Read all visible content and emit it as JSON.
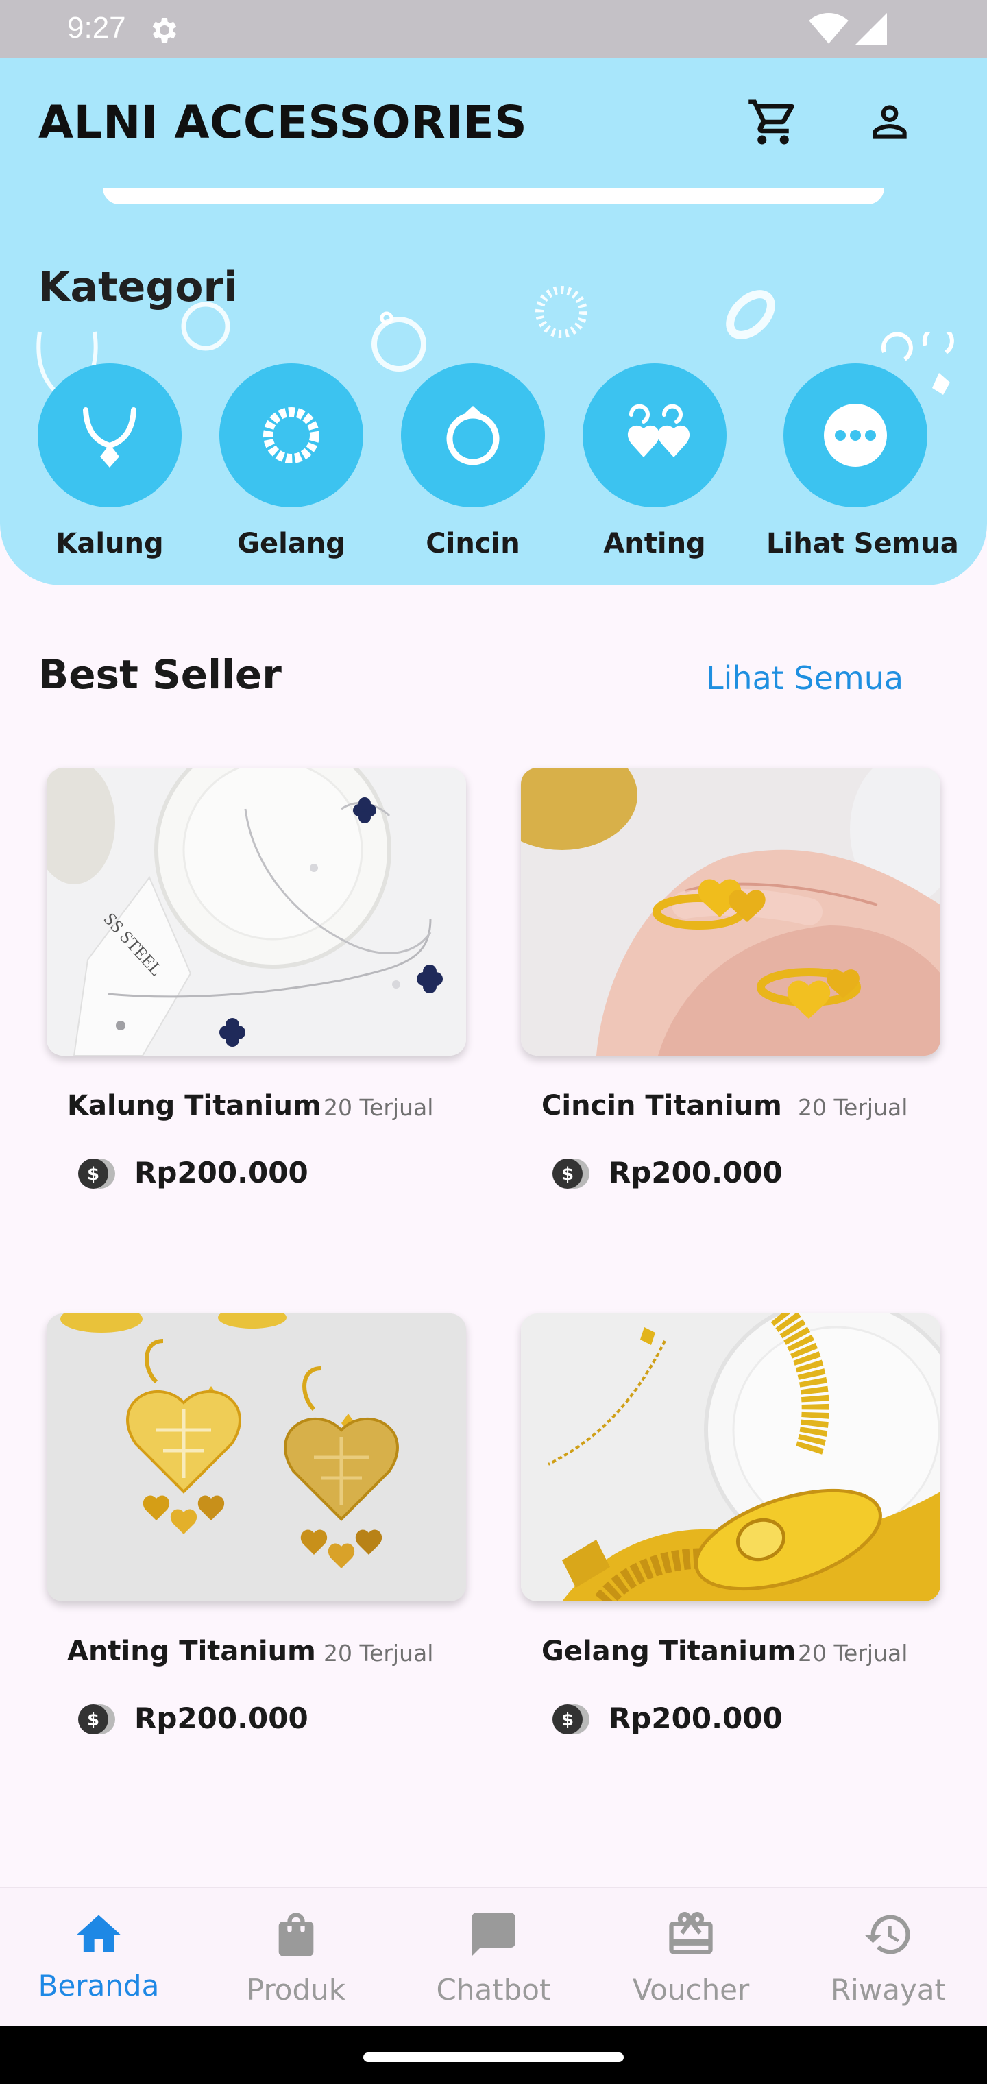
{
  "status_bar": {
    "time": "9:27"
  },
  "header": {
    "title": "ALNI ACCESSORIES"
  },
  "kategori": {
    "title": "Kategori",
    "items": [
      {
        "label": "Kalung",
        "icon": "necklace-icon"
      },
      {
        "label": "Gelang",
        "icon": "bracelet-icon"
      },
      {
        "label": "Cincin",
        "icon": "ring-icon"
      },
      {
        "label": "Anting",
        "icon": "earrings-icon"
      },
      {
        "label": "Lihat Semua",
        "icon": "more-dots-icon"
      }
    ]
  },
  "best_seller": {
    "title": "Best Seller",
    "see_all": "Lihat Semua",
    "products": [
      {
        "name": "Kalung Titanium",
        "sold": "20 Terjual",
        "price": "Rp200.000"
      },
      {
        "name": "Cincin Titanium",
        "sold": "20 Terjual",
        "price": "Rp200.000"
      },
      {
        "name": "Anting Titanium",
        "sold": "20 Terjual",
        "price": "Rp200.000"
      },
      {
        "name": "Gelang Titanium",
        "sold": "20 Terjual",
        "price": "Rp200.000"
      }
    ]
  },
  "bottom_nav": {
    "items": [
      {
        "label": "Beranda",
        "icon": "home-icon",
        "active": true
      },
      {
        "label": "Produk",
        "icon": "shopping-bag-icon",
        "active": false
      },
      {
        "label": "Chatbot",
        "icon": "chat-icon",
        "active": false
      },
      {
        "label": "Voucher",
        "icon": "gift-card-icon",
        "active": false
      },
      {
        "label": "Riwayat",
        "icon": "history-icon",
        "active": false
      }
    ]
  },
  "colors": {
    "header_bg": "#a8e6fb",
    "category_circle": "#3cc3f0",
    "accent_link": "#1f8fe0",
    "nav_active": "#1e88e5",
    "nav_inactive": "#9a9a9a"
  }
}
